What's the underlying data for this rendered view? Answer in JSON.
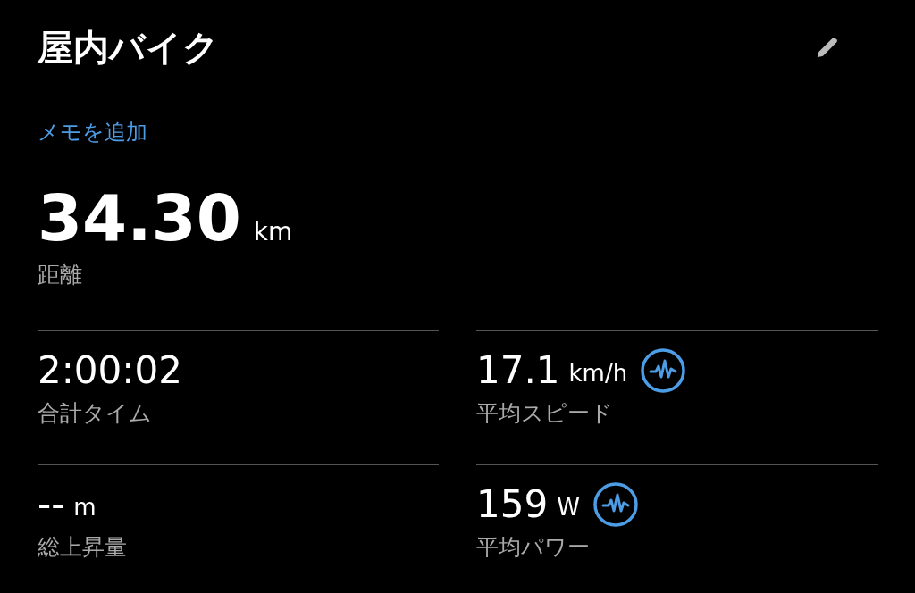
{
  "title": "屋内バイク",
  "memo_link": "メモを追加",
  "distance": {
    "value": "34.30",
    "unit": "km",
    "label": "距離"
  },
  "stats": [
    {
      "value": "2:00:02",
      "label": "合計タイム",
      "analysis": false
    },
    {
      "value": "17.1",
      "unit": "km/h",
      "label": "平均スピード",
      "analysis": true
    },
    {
      "value": "--",
      "unit": "m",
      "label": "総上昇量",
      "analysis": false
    },
    {
      "value": "159",
      "unit": "W",
      "label": "平均パワー",
      "analysis": true
    }
  ]
}
